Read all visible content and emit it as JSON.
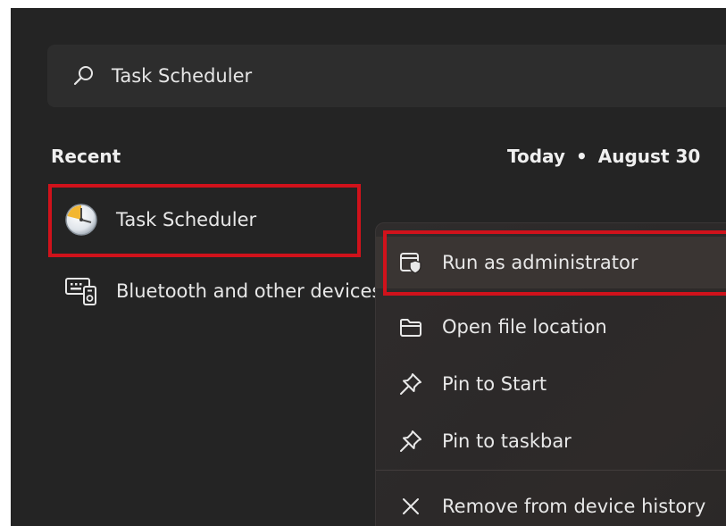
{
  "search": {
    "query": "Task Scheduler"
  },
  "recent": {
    "heading": "Recent",
    "date_today": "Today",
    "date_separator": "•",
    "date_value": "August 30",
    "items": [
      {
        "label": "Task Scheduler",
        "icon": "clock-icon"
      },
      {
        "label": "Bluetooth and other devices",
        "icon": "keyboard-icon"
      }
    ]
  },
  "context_menu": {
    "items": [
      {
        "label": "Run as administrator",
        "icon": "shield-window-icon"
      },
      {
        "label": "Open file location",
        "icon": "folder-icon"
      },
      {
        "label": "Pin to Start",
        "icon": "pin-icon"
      },
      {
        "label": "Pin to taskbar",
        "icon": "pin-icon"
      },
      {
        "label": "Remove from device history",
        "icon": "close-icon"
      }
    ]
  },
  "colors": {
    "panel_background": "#242424",
    "highlight_border": "#d0121b",
    "text": "#e8e8e8"
  }
}
